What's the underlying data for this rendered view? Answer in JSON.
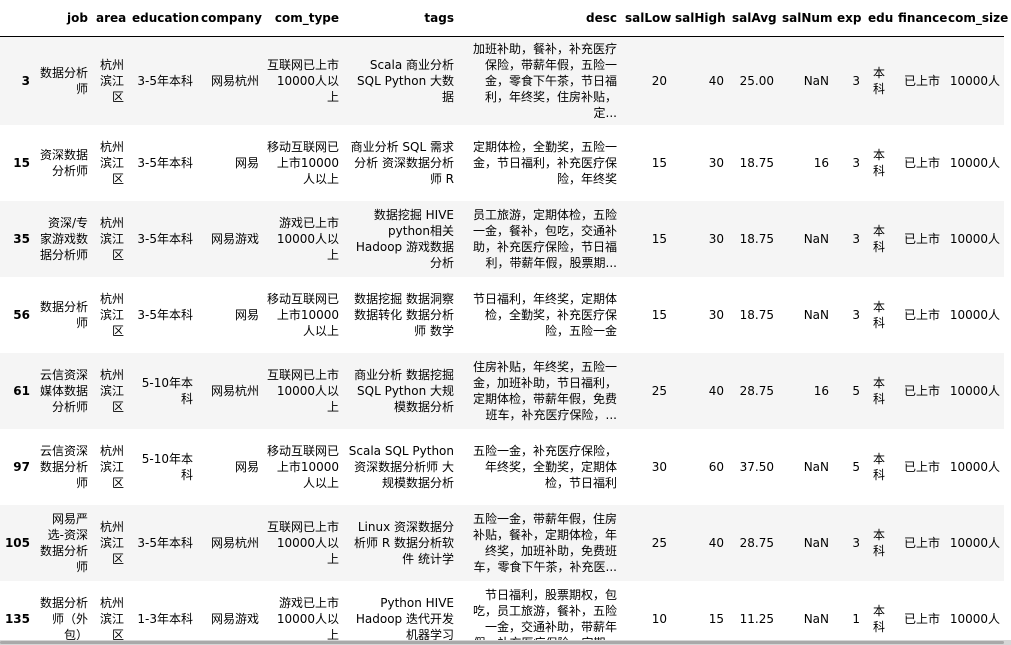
{
  "columns": [
    "",
    "job",
    "area",
    "education",
    "company",
    "com_type",
    "tags",
    "desc",
    "salLow",
    "salHigh",
    "salAvg",
    "salNum",
    "exp",
    "edu",
    "finance",
    "com_size"
  ],
  "rows": [
    {
      "idx": "3",
      "job": "数据分析师",
      "area": "杭州滨江区",
      "education": "3-5年本科",
      "company": "网易杭州",
      "com_type": "互联网已上市10000人以上",
      "tags": "Scala 商业分析 SQL Python 大数据",
      "desc": "加班补助，餐补，补充医疗保险，带薪年假，五险一金，零食下午茶，节日福利，年终奖，住房补贴，定...",
      "salLow": "20",
      "salHigh": "40",
      "salAvg": "25.00",
      "salNum": "NaN",
      "exp": "3",
      "edu": "本科",
      "finance": "已上市",
      "com_size": "10000人"
    },
    {
      "idx": "15",
      "job": "资深数据分析师",
      "area": "杭州滨江区",
      "education": "3-5年本科",
      "company": "网易",
      "com_type": "移动互联网已上市10000人以上",
      "tags": "商业分析 SQL 需求分析 资深数据分析师 R",
      "desc": "定期体检，全勤奖，五险一金，节日福利，补充医疗保险，年终奖",
      "salLow": "15",
      "salHigh": "30",
      "salAvg": "18.75",
      "salNum": "16",
      "exp": "3",
      "edu": "本科",
      "finance": "已上市",
      "com_size": "10000人"
    },
    {
      "idx": "35",
      "job": "资深/专家游戏数据分析师",
      "area": "杭州滨江区",
      "education": "3-5年本科",
      "company": "网易游戏",
      "com_type": "游戏已上市10000人以上",
      "tags": "数据挖掘 HIVE python相关 Hadoop 游戏数据分析",
      "desc": "员工旅游，定期体检，五险一金，餐补，包吃，交通补助，补充医疗保险，节日福利，带薪年假，股票期...",
      "salLow": "15",
      "salHigh": "30",
      "salAvg": "18.75",
      "salNum": "NaN",
      "exp": "3",
      "edu": "本科",
      "finance": "已上市",
      "com_size": "10000人"
    },
    {
      "idx": "56",
      "job": "数据分析师",
      "area": "杭州滨江区",
      "education": "3-5年本科",
      "company": "网易",
      "com_type": "移动互联网已上市10000人以上",
      "tags": "数据挖掘 数据洞察 数据转化 数据分析师 数学",
      "desc": "节日福利，年终奖，定期体检，全勤奖，补充医疗保险，五险一金",
      "salLow": "15",
      "salHigh": "30",
      "salAvg": "18.75",
      "salNum": "NaN",
      "exp": "3",
      "edu": "本科",
      "finance": "已上市",
      "com_size": "10000人"
    },
    {
      "idx": "61",
      "job": "云信资深媒体数据分析师",
      "area": "杭州滨江区",
      "education": "5-10年本科",
      "company": "网易杭州",
      "com_type": "互联网已上市10000人以上",
      "tags": "商业分析 数据挖掘 SQL Python 大规模数据分析",
      "desc": "住房补贴，年终奖，五险一金，加班补助，节日福利，定期体检，带薪年假，免费班车，补充医疗保险，...",
      "salLow": "25",
      "salHigh": "40",
      "salAvg": "28.75",
      "salNum": "16",
      "exp": "5",
      "edu": "本科",
      "finance": "已上市",
      "com_size": "10000人"
    },
    {
      "idx": "97",
      "job": "云信资深数据分析师",
      "area": "杭州滨江区",
      "education": "5-10年本科",
      "company": "网易",
      "com_type": "移动互联网已上市10000人以上",
      "tags": "Scala SQL Python 资深数据分析师 大规模数据分析",
      "desc": "五险一金，补充医疗保险，年终奖，全勤奖，定期体检，节日福利",
      "salLow": "30",
      "salHigh": "60",
      "salAvg": "37.50",
      "salNum": "NaN",
      "exp": "5",
      "edu": "本科",
      "finance": "已上市",
      "com_size": "10000人"
    },
    {
      "idx": "105",
      "job": "网易严选-资深数据分析师",
      "area": "杭州滨江区",
      "education": "3-5年本科",
      "company": "网易杭州",
      "com_type": "互联网已上市10000人以上",
      "tags": "Linux 资深数据分析师 R 数据分析软件 统计学",
      "desc": "五险一金，带薪年假，住房补贴，餐补，定期体检，年终奖，加班补助，免费班车，零食下午茶，补充医...",
      "salLow": "25",
      "salHigh": "40",
      "salAvg": "28.75",
      "salNum": "NaN",
      "exp": "3",
      "edu": "本科",
      "finance": "已上市",
      "com_size": "10000人"
    },
    {
      "idx": "135",
      "job": "数据分析师（外包）",
      "area": "杭州滨江区",
      "education": "1-3年本科",
      "company": "网易游戏",
      "com_type": "游戏已上市10000人以上",
      "tags": "Python HIVE Hadoop 迭代开发 机器学习",
      "desc": "节日福利，股票期权，包吃，员工旅游，餐补，五险一金，交通补助，带薪年假，补充医疗保险，定期...",
      "salLow": "10",
      "salHigh": "15",
      "salAvg": "11.25",
      "salNum": "NaN",
      "exp": "1",
      "edu": "本科",
      "finance": "已上市",
      "com_size": "10000人"
    }
  ]
}
